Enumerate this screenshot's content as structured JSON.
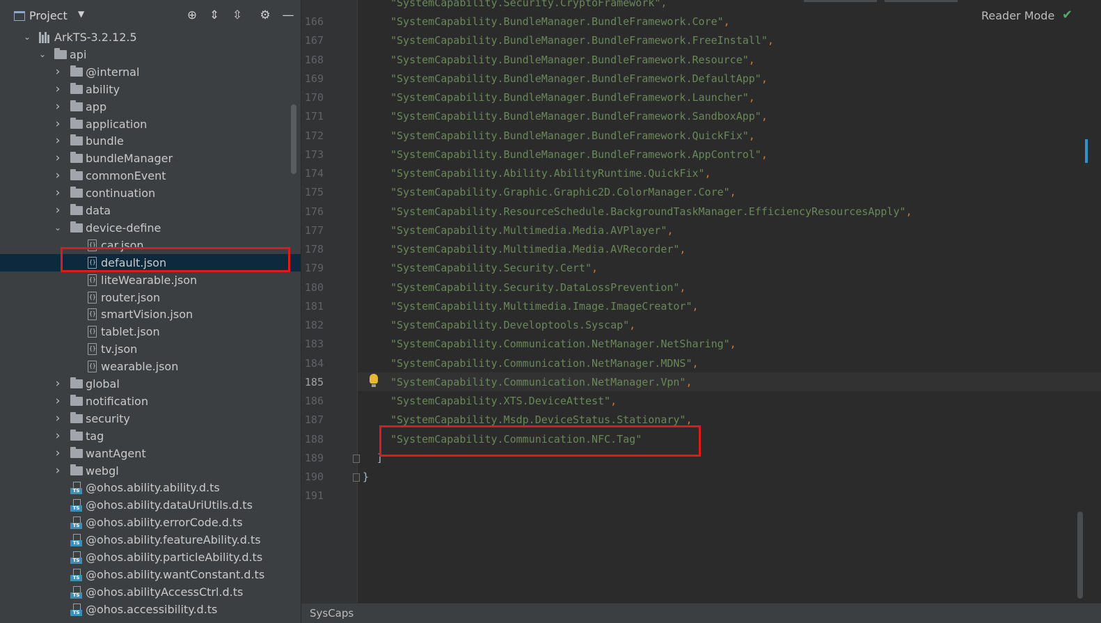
{
  "panel": {
    "title": "Project",
    "dropdown_icon": "chevron-down-icon",
    "tools": [
      "locate-icon",
      "expand-all-icon",
      "collapse-all-icon",
      "gear-icon",
      "hide-icon"
    ]
  },
  "tree": {
    "root": "ArkTS-3.2.12.5",
    "api": "api",
    "folders_a": [
      "@internal",
      "ability",
      "app",
      "application",
      "bundle",
      "bundleManager",
      "commonEvent",
      "continuation",
      "data"
    ],
    "device_define": "device-define",
    "json_files": [
      "car.json",
      "default.json",
      "liteWearable.json",
      "router.json",
      "smartVision.json",
      "tablet.json",
      "tv.json",
      "wearable.json"
    ],
    "folders_b": [
      "global",
      "notification",
      "security",
      "tag",
      "wantAgent",
      "webgl"
    ],
    "ts_files": [
      "@ohos.ability.ability.d.ts",
      "@ohos.ability.dataUriUtils.d.ts",
      "@ohos.ability.errorCode.d.ts",
      "@ohos.ability.featureAbility.d.ts",
      "@ohos.ability.particleAbility.d.ts",
      "@ohos.ability.wantConstant.d.ts",
      "@ohos.abilityAccessCtrl.d.ts",
      "@ohos.accessibility.d.ts"
    ],
    "selected": "default.json"
  },
  "editor": {
    "reader_mode": "Reader Mode",
    "current_line": 185,
    "partial_top": "\"SystemCapability.Security.CryptoFramework\",",
    "lines": [
      {
        "n": 166,
        "s": "\"SystemCapability.BundleManager.BundleFramework.Core\"",
        "p": ","
      },
      {
        "n": 167,
        "s": "\"SystemCapability.BundleManager.BundleFramework.FreeInstall\"",
        "p": ","
      },
      {
        "n": 168,
        "s": "\"SystemCapability.BundleManager.BundleFramework.Resource\"",
        "p": ","
      },
      {
        "n": 169,
        "s": "\"SystemCapability.BundleManager.BundleFramework.DefaultApp\"",
        "p": ","
      },
      {
        "n": 170,
        "s": "\"SystemCapability.BundleManager.BundleFramework.Launcher\"",
        "p": ","
      },
      {
        "n": 171,
        "s": "\"SystemCapability.BundleManager.BundleFramework.SandboxApp\"",
        "p": ","
      },
      {
        "n": 172,
        "s": "\"SystemCapability.BundleManager.BundleFramework.QuickFix\"",
        "p": ","
      },
      {
        "n": 173,
        "s": "\"SystemCapability.BundleManager.BundleFramework.AppControl\"",
        "p": ","
      },
      {
        "n": 174,
        "s": "\"SystemCapability.Ability.AbilityRuntime.QuickFix\"",
        "p": ","
      },
      {
        "n": 175,
        "s": "\"SystemCapability.Graphic.Graphic2D.ColorManager.Core\"",
        "p": ","
      },
      {
        "n": 176,
        "s": "\"SystemCapability.ResourceSchedule.BackgroundTaskManager.EfficiencyResourcesApply\"",
        "p": ","
      },
      {
        "n": 177,
        "s": "\"SystemCapability.Multimedia.Media.AVPlayer\"",
        "p": ","
      },
      {
        "n": 178,
        "s": "\"SystemCapability.Multimedia.Media.AVRecorder\"",
        "p": ","
      },
      {
        "n": 179,
        "s": "\"SystemCapability.Security.Cert\"",
        "p": ","
      },
      {
        "n": 180,
        "s": "\"SystemCapability.Security.DataLossPrevention\"",
        "p": ","
      },
      {
        "n": 181,
        "s": "\"SystemCapability.Multimedia.Image.ImageCreator\"",
        "p": ","
      },
      {
        "n": 182,
        "s": "\"SystemCapability.Developtools.Syscap\"",
        "p": ","
      },
      {
        "n": 183,
        "s": "\"SystemCapability.Communication.NetManager.NetSharing\"",
        "p": ","
      },
      {
        "n": 184,
        "s": "\"SystemCapability.Communication.NetManager.MDNS\"",
        "p": ","
      },
      {
        "n": 185,
        "s": "\"SystemCapability.Communication.NetManager.Vpn\"",
        "p": ","
      },
      {
        "n": 186,
        "s": "\"SystemCapability.XTS.DeviceAttest\"",
        "p": ","
      },
      {
        "n": 187,
        "s": "\"SystemCapability.Msdp.DeviceStatus.Stationary\"",
        "p": ","
      },
      {
        "n": 188,
        "s": "\"SystemCapability.Communication.NFC.Tag\"",
        "p": ""
      },
      {
        "n": 189,
        "b": "]"
      },
      {
        "n": 190,
        "b": "}"
      },
      {
        "n": 191,
        "b": ""
      }
    ]
  },
  "breadcrumb": "SysCaps",
  "colors": {
    "string": "#6a8759",
    "punctuation": "#cc7832",
    "highlight": "#e0191d",
    "selection": "#0d293e"
  }
}
